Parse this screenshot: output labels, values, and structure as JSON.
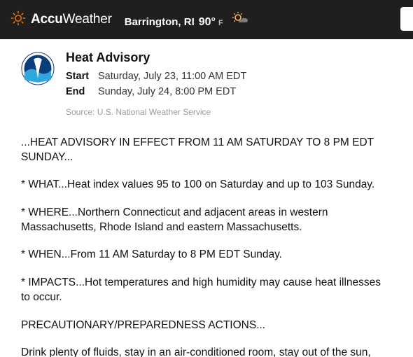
{
  "header": {
    "brand_bold": "Accu",
    "brand_light": "Weather",
    "location": "Barrington, RI",
    "temp": "90°",
    "unit": "F"
  },
  "alert": {
    "title": "Heat Advisory",
    "start_label": "Start",
    "start_value": "Saturday, July 23, 11:00 AM EDT",
    "end_label": "End",
    "end_value": "Sunday, July 24, 8:00 PM EDT",
    "source": "Source: U.S. National Weather Service"
  },
  "body": {
    "p0": "...HEAT ADVISORY IN EFFECT FROM 11 AM SATURDAY TO 8 PM EDT SUNDAY...",
    "p1": "* WHAT...Heat index values 95 to 100 on Saturday and up to 103 Sunday.",
    "p2": "* WHERE...Northern Connecticut and adjacent areas in western Massachusetts, Rhode Island and eastern Massachusetts.",
    "p3": "* WHEN...From 11 AM Saturday to 8 PM EDT Sunday.",
    "p4": "* IMPACTS...Hot temperatures and high humidity may cause heat illnesses to occur.",
    "p5": "PRECAUTIONARY/PREPAREDNESS ACTIONS...",
    "p6": "Drink plenty of fluids, stay in an air-conditioned room, stay out of the sun,"
  }
}
